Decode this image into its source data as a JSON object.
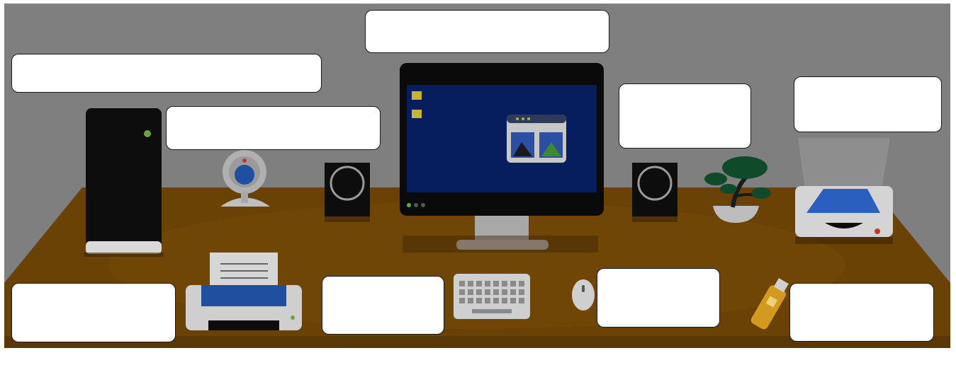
{
  "worksheet": {
    "background_color": "#7f7f7f",
    "desk_color": "#6b4206",
    "label_boxes": [
      {
        "id": "monitor-label",
        "text": ""
      },
      {
        "id": "tower-label",
        "text": ""
      },
      {
        "id": "webcam-label",
        "text": ""
      },
      {
        "id": "speaker-label",
        "text": ""
      },
      {
        "id": "scanner-label",
        "text": ""
      },
      {
        "id": "printer-label",
        "text": ""
      },
      {
        "id": "keyboard-label",
        "text": ""
      },
      {
        "id": "mouse-label",
        "text": ""
      },
      {
        "id": "usb-drive-label",
        "text": ""
      }
    ],
    "items": [
      "computer-tower",
      "webcam",
      "speaker-left",
      "monitor",
      "speaker-right",
      "bonsai-plant",
      "scanner",
      "printer",
      "keyboard",
      "mouse",
      "usb-flash-drive"
    ]
  }
}
